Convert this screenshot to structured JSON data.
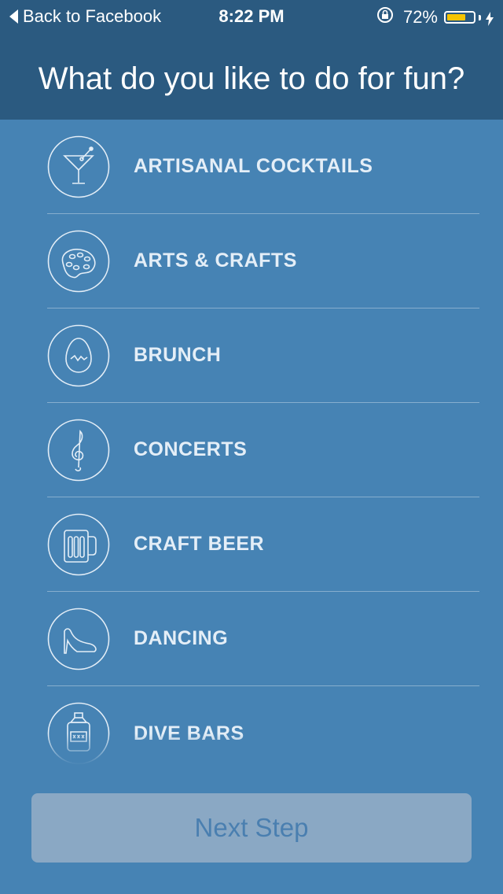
{
  "status_bar": {
    "back_label": "Back to Facebook",
    "time": "8:22 PM",
    "battery_percent_label": "72%",
    "battery_level": 0.72,
    "battery_color": "#f5c400"
  },
  "header": {
    "title": "What do you like to do for fun?"
  },
  "activities": [
    {
      "label": "ARTISANAL COCKTAILS",
      "icon": "cocktail-icon"
    },
    {
      "label": "ARTS & CRAFTS",
      "icon": "palette-icon"
    },
    {
      "label": "BRUNCH",
      "icon": "egg-icon"
    },
    {
      "label": "CONCERTS",
      "icon": "treble-clef-icon"
    },
    {
      "label": "CRAFT BEER",
      "icon": "beer-mug-icon"
    },
    {
      "label": "DANCING",
      "icon": "high-heel-icon"
    },
    {
      "label": "DIVE BARS",
      "icon": "whiskey-jug-icon"
    }
  ],
  "footer": {
    "next_label": "Next Step"
  },
  "colors": {
    "header_bg": "#2b5a80",
    "body_bg": "#4683b4",
    "button_bg": "#8aa8c4",
    "button_text": "#4a7fb0"
  }
}
